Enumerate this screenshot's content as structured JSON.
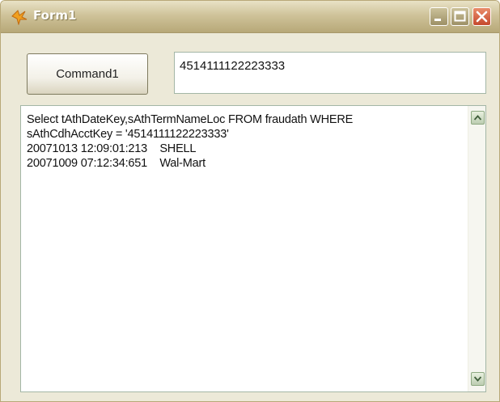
{
  "window": {
    "title": "Form1"
  },
  "form": {
    "command_label": "Command1",
    "input_value": "4514111122223333",
    "output_lines": [
      "Select tAthDateKey,sAthTermNameLoc FROM fraudath WHERE",
      "sAthCdhAcctKey = '4514111122223333'",
      "20071013 12:09:01:213    SHELL",
      "20071009 07:12:34:651    Wal-Mart"
    ]
  },
  "icons": {
    "app": "form-app-icon",
    "minimize": "minimize-icon",
    "maximize": "maximize-icon",
    "close": "close-icon",
    "scroll_up": "scroll-up-arrow-icon",
    "scroll_down": "scroll-down-arrow-icon"
  },
  "colors": {
    "titlebar": "#cfc39a",
    "client_background": "#ece9d8",
    "close_button": "#c5482c"
  }
}
